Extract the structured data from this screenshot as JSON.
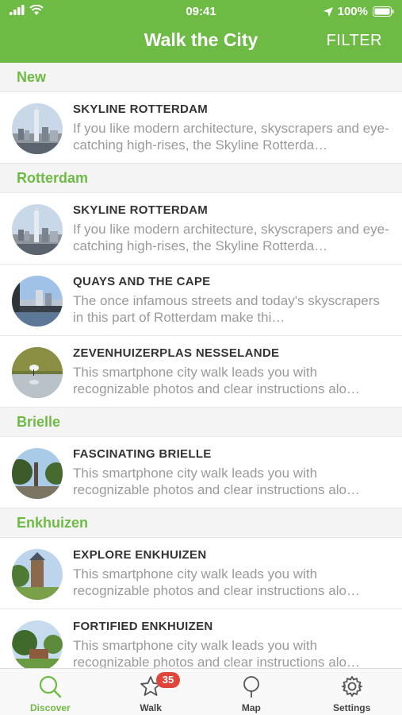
{
  "status_bar": {
    "time": "09:41",
    "battery": "100%"
  },
  "header": {
    "title": "Walk the City",
    "filter_label": "FILTER"
  },
  "sections": [
    {
      "name": "New",
      "items": [
        {
          "title": "SKYLINE ROTTERDAM",
          "description": "If you like modern architecture, skyscrapers and eye-catching high-rises, the Skyline Rotterda…"
        }
      ]
    },
    {
      "name": "Rotterdam",
      "items": [
        {
          "title": "SKYLINE ROTTERDAM",
          "description": "If you like modern architecture, skyscrapers and eye-catching high-rises, the Skyline Rotterda…"
        },
        {
          "title": "QUAYS AND THE CAPE",
          "description": "The once infamous streets and today's skyscrapers in this part of Rotterdam make thi…"
        },
        {
          "title": "ZEVENHUIZERPLAS NESSELANDE",
          "description": "This smartphone city walk leads you with recognizable photos and clear instructions alo…"
        }
      ]
    },
    {
      "name": "Brielle",
      "items": [
        {
          "title": "FASCINATING BRIELLE",
          "description": "This smartphone city walk leads you with recognizable photos and clear instructions alo…"
        }
      ]
    },
    {
      "name": "Enkhuizen",
      "items": [
        {
          "title": "EXPLORE ENKHUIZEN",
          "description": "This smartphone city walk leads you with recognizable photos and clear instructions alo…"
        },
        {
          "title": "FORTIFIED ENKHUIZEN",
          "description": "This smartphone city walk leads you with recognizable photos and clear instructions alo…"
        }
      ]
    }
  ],
  "tabbar": {
    "discover": "Discover",
    "walk": "Walk",
    "walk_badge": "35",
    "map": "Map",
    "settings": "Settings"
  },
  "colors": {
    "accent": "#6dbb45",
    "badge": "#e0453c",
    "muted_text": "#9a9a9a"
  }
}
